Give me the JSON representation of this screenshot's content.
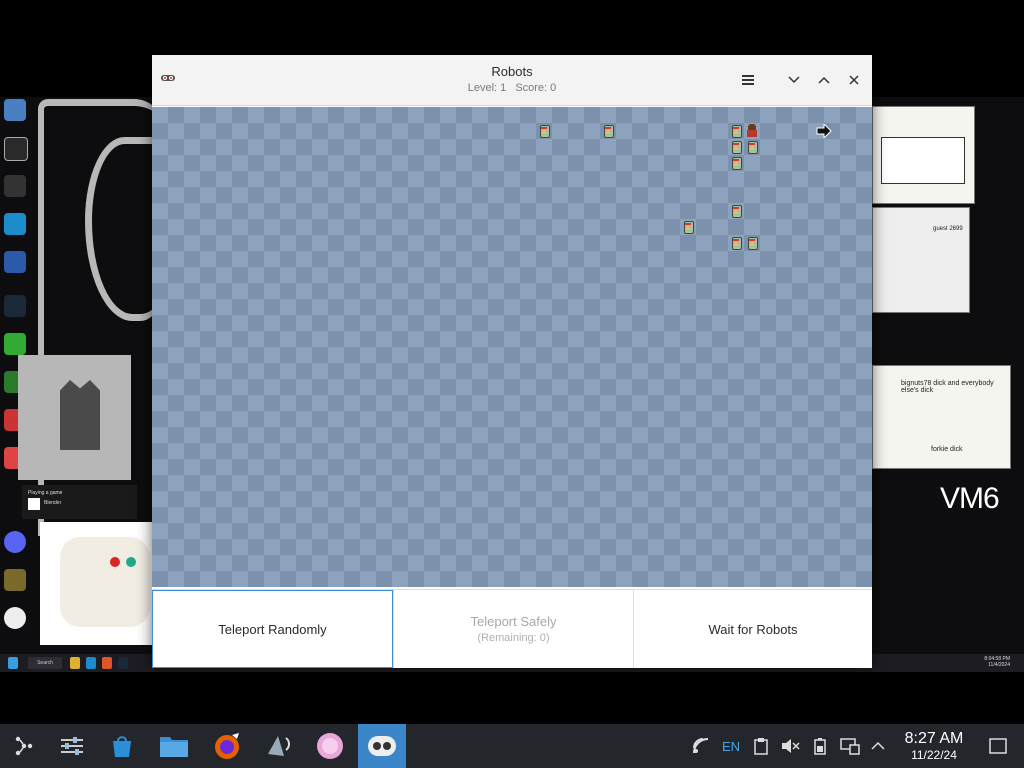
{
  "window": {
    "title": "Robots",
    "level_label": "Level: 1",
    "score_label": "Score: 0",
    "controls": {
      "menu": "hamburger-icon",
      "minimize": "chevron-down-icon",
      "maximize": "chevron-up-icon",
      "close": "close-icon"
    }
  },
  "game": {
    "robot_count": 11,
    "player_count": 1
  },
  "buttons": {
    "teleport_randomly": "Teleport Randomly",
    "teleport_safely": "Teleport Safely",
    "teleport_safely_remaining": "(Remaining: 0)",
    "wait_for_robots": "Wait for Robots"
  },
  "background": {
    "vm_label": "VM6",
    "note_text": "bignuts78 dick and everybody else's dick",
    "note_sub": "forkie dick",
    "toast_title": "Playing a game",
    "toast_app": "Blender",
    "sketch_label": "guest 2699",
    "vm_clock_time": "8:04:58 PM",
    "vm_clock_date": "11/4/2024",
    "vm_search": "Search"
  },
  "taskbar": {
    "language": "EN",
    "time": "8:27 AM",
    "date": "11/22/24",
    "apps": [
      "steam-icon",
      "settings-mixer-icon",
      "discover-store-icon",
      "file-manager-icon",
      "firefox-icon",
      "audio-app-icon",
      "pink-app-icon",
      "robots-app-icon"
    ]
  },
  "colors": {
    "accent": "#3a86c8",
    "board_light": "#8da3bd",
    "board_dark": "#7c92ac",
    "taskbar": "#23262b"
  }
}
